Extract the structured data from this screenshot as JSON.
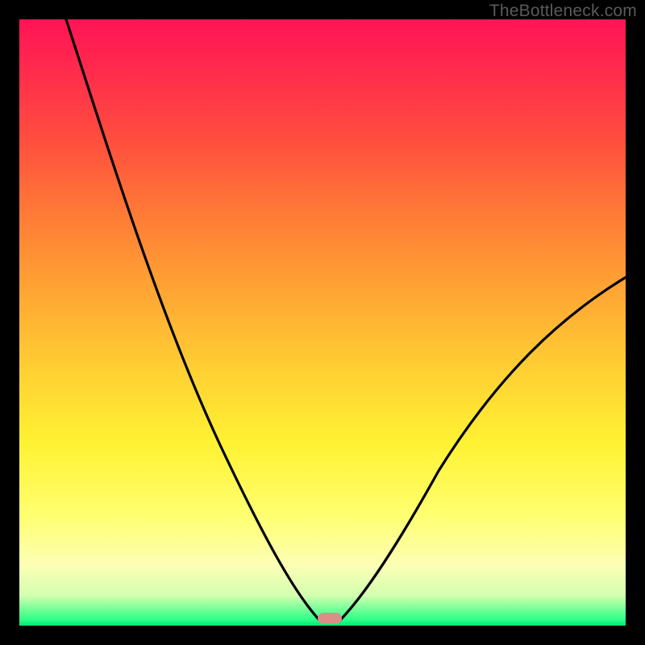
{
  "attribution": "TheBottleneck.com",
  "colors": {
    "frame": "#000000",
    "gradient_top": "#ff1455",
    "gradient_mid": "#ffd033",
    "gradient_low": "#fcffb5",
    "gradient_bottom": "#00e676",
    "curve": "#000000",
    "marker": "#d98f88"
  },
  "chart_data": {
    "type": "line",
    "title": "",
    "xlabel": "",
    "ylabel": "",
    "xlim": [
      0,
      100
    ],
    "ylim": [
      0,
      100
    ],
    "grid": false,
    "legend": false,
    "note": "V-shaped bottleneck curve; y = 0 represents perfect match at bottom green band; x is component balance axis",
    "series": [
      {
        "name": "bottleneck-curve",
        "x": [
          0,
          5,
          10,
          15,
          20,
          25,
          30,
          35,
          40,
          45,
          48,
          50,
          52,
          55,
          60,
          65,
          70,
          75,
          80,
          85,
          90,
          95,
          100
        ],
        "y": [
          100,
          90,
          80,
          70,
          60,
          50,
          40,
          30,
          20,
          10,
          4,
          0,
          0,
          4,
          10,
          18,
          24,
          30,
          36,
          42,
          47,
          52,
          57
        ]
      }
    ],
    "annotations": [
      {
        "name": "optimal-marker",
        "x": 51,
        "y": 0
      }
    ]
  }
}
